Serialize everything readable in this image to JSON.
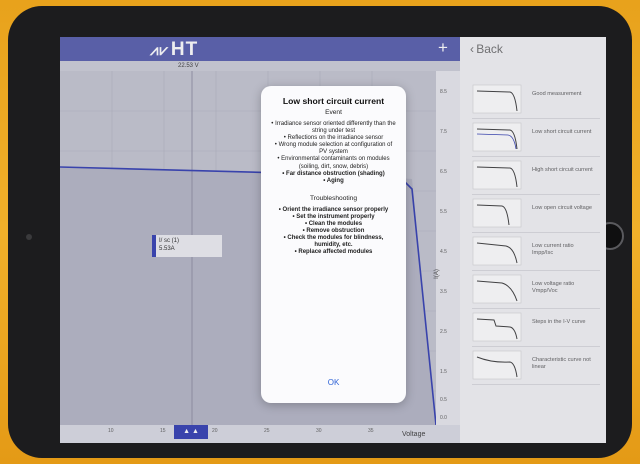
{
  "app": {
    "logo": "HT",
    "plus": "+",
    "back_label": "Back",
    "voltage_marker": "22.53 V"
  },
  "chart": {
    "y_axis_name": "I(A)",
    "x_axis_name": "Voltage",
    "y_ticks": [
      "8.5",
      "7.5",
      "6.5",
      "5.5",
      "4.5",
      "3.5",
      "2.5",
      "1.5",
      "0.5",
      "0.0"
    ],
    "x_ticks": [
      "10",
      "15",
      "20",
      "25",
      "30",
      "35"
    ],
    "point_label_1": "I/ sc (1)",
    "point_label_2": "5.53A",
    "bottom_button": "▲ ▲"
  },
  "dialog": {
    "title": "Low short circuit current",
    "event_heading": "Event",
    "events": [
      "• Irradiance sensor oriented differently than the string under test",
      "• Reflections on the irradiance sensor",
      "• Wrong module selection at configuration of PV system",
      "• Environmental contaminants on modules (soiling, dirt, snow, debris)",
      "• Far distance obstruction (shading)",
      "• Aging"
    ],
    "troubleshooting_heading": "Troubleshooting",
    "steps": [
      "• Orient the irradiance sensor properly",
      "• Set the instrument properly",
      "• Clean the modules",
      "• Remove obstruction",
      "• Check the modules for blindness, humidity, etc.",
      "• Replace affected modules"
    ],
    "ok_label": "OK"
  },
  "curves": [
    {
      "label": "Good measurement"
    },
    {
      "label": "Low short circuit current"
    },
    {
      "label": "High short circuit current"
    },
    {
      "label": "Low open circuit voltage"
    },
    {
      "label": "Low current ratio Impp/Isc"
    },
    {
      "label": "Low voltage ratio Vmpp/Voc"
    },
    {
      "label": "Steps in the I-V curve"
    },
    {
      "label": "Characteristic curve not linear"
    }
  ],
  "colors": {
    "accent": "#5e64b0",
    "background": "#f1b02a",
    "link": "#2f63d6"
  }
}
